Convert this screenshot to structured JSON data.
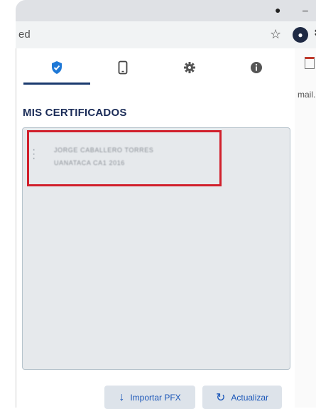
{
  "browser": {
    "url_fragment": "ed",
    "background_fragment": "mail."
  },
  "tabs": [
    {
      "name": "certificates",
      "icon": "shield-check-icon",
      "active": true
    },
    {
      "name": "mobile",
      "icon": "mobile-icon",
      "active": false
    },
    {
      "name": "settings",
      "icon": "gear-icon",
      "active": false
    },
    {
      "name": "info",
      "icon": "info-icon",
      "active": false
    }
  ],
  "section_title": "MIS CERTIFICADOS",
  "certificates": [
    {
      "name": "JORGE CABALLERO TORRES",
      "description": "UANATACA CA1 2016"
    }
  ],
  "buttons": {
    "import": "Importar PFX",
    "refresh": "Actualizar"
  },
  "colors": {
    "accent": "#1a3a6e",
    "highlight": "#d1202c",
    "button_text": "#1a56b8"
  }
}
